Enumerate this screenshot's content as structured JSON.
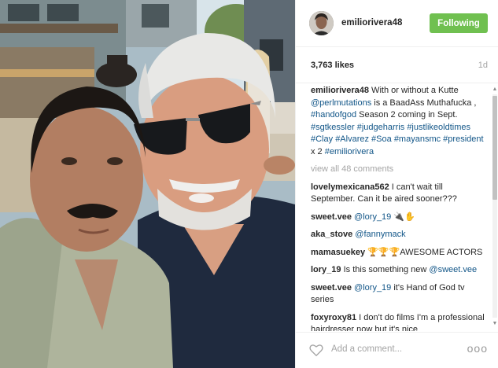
{
  "post": {
    "username": "emiliorivera48",
    "follow_label": "Following",
    "likes": "3,763 likes",
    "age": "1d"
  },
  "caption": {
    "user": "emiliorivera48",
    "t1": " With or without a Kutte ",
    "m1": "@perlmutations",
    "t2": " is a BaadAss Muthafucka , ",
    "h1": "#handofgod",
    "t3": " Season 2 coming in Sept. ",
    "h2": "#sgtkessler",
    "t4": " ",
    "h3": "#judgeharris",
    "t5": " ",
    "h4": "#justlikeoldtimes",
    "t6": " ",
    "h5": "#Clay",
    "t7": " ",
    "h6": "#Alvarez",
    "t8": " ",
    "h7": "#Soa",
    "t9": " ",
    "h8": "#mayansmc",
    "t10": " ",
    "h9": "#president",
    "t11": " x 2 ",
    "h10": "#emiliorivera"
  },
  "view_all": "view all 48 comments",
  "comments": [
    {
      "user": "lovelymexicana562",
      "text": " I can't wait till September. Can it be aired sooner???"
    },
    {
      "user": "sweet.vee",
      "mention": "@lory_19",
      "text": " 🔌✋"
    },
    {
      "user": "aka_stove",
      "mention": "@fannymack",
      "text": ""
    },
    {
      "user": "mamasuekey",
      "text": " 🏆🏆🏆AWESOME ACTORS"
    },
    {
      "user": "lory_19",
      "text": " Is this something new ",
      "mention_after": "@sweet.vee"
    },
    {
      "user": "sweet.vee",
      "mention": "@lory_19",
      "text": " it's Hand of God tv series"
    },
    {
      "user": "foxyroxy81",
      "text": " I don't do films I'm a professional hairdresser now but it's nice"
    }
  ],
  "footer": {
    "add_comment_placeholder": "Add a comment...",
    "more_label": "ooo"
  },
  "icons": {
    "heart": "heart-outline-icon",
    "more": "more-options-icon"
  },
  "colors": {
    "follow_button": "#70c050",
    "hashtag": "#125688",
    "muted_text": "#a5a5a5"
  }
}
